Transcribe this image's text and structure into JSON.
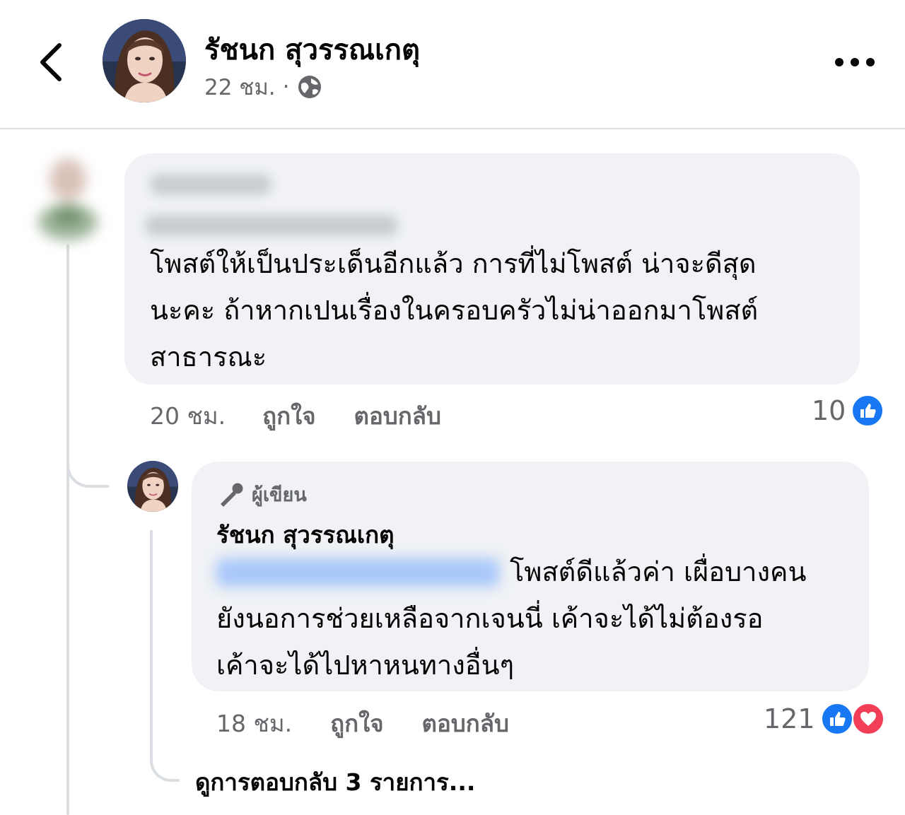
{
  "header": {
    "author_name": "รัชนก สุวรรณเกตุ",
    "time": "22 ชม.",
    "separator": "·",
    "privacy_icon": "globe-icon",
    "back_icon": "chevron-left-icon",
    "more_icon": "more-dots-icon"
  },
  "comment": {
    "text_lines": [
      "โพสต์ให้เป็นประเด็นอีกแล้ว การที่ไม่โพสต์ น่าจะดีสุด",
      "นะคะ  ถ้าหากเปนเรื่องในครอบครัวไม่น่าออกมาโพสต์",
      "สาธารณะ"
    ],
    "time": "20 ชม.",
    "like_label": "ถูกใจ",
    "reply_label": "ตอบกลับ",
    "reaction_count": "10",
    "reactions": [
      "like-icon"
    ]
  },
  "reply": {
    "badge_label": "ผู้เขียน",
    "badge_icon": "microphone-icon",
    "author_name": "รัชนก สุวรรณเกตุ",
    "text_lines": [
      "โพสต์ดีแล้วค่า เผื่อบางคน",
      "ยังนอการช่วยเหลือจากเจนนี่ เค้าจะได้ไม่ต้องรอ",
      "เค้าจะได้ไปหาหนทางอื่นๆ"
    ],
    "time": "18 ชม.",
    "like_label": "ถูกใจ",
    "reply_label": "ตอบกลับ",
    "reaction_count": "121",
    "reactions": [
      "like-icon",
      "love-icon"
    ]
  },
  "view_more_replies": "ดูการตอบกลับ 3 รายการ...",
  "colors": {
    "accent_blue": "#1877f2",
    "love_red": "#f33e58",
    "bubble_bg": "#f0f2f5",
    "muted_text": "#65676b"
  }
}
